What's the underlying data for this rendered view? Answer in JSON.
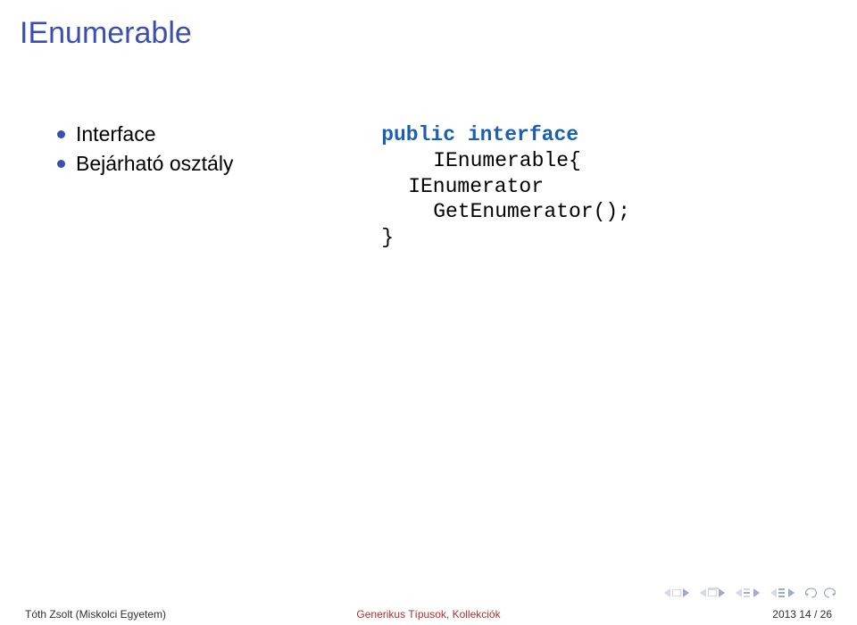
{
  "title": "IEnumerable",
  "bullets": [
    {
      "label": "Interface"
    },
    {
      "label": "Bejárható osztály"
    }
  ],
  "code": {
    "kw_public": "public",
    "kw_interface": "interface",
    "type_name": "IEnumerable{",
    "line2": "IEnumerator",
    "line3": "GetEnumerator();",
    "close": "}"
  },
  "footer": {
    "left": "Tóth Zsolt (Miskolci Egyetem)",
    "center": "Generikus Típusok, Kollekciók",
    "right": "2013    14 / 26"
  }
}
